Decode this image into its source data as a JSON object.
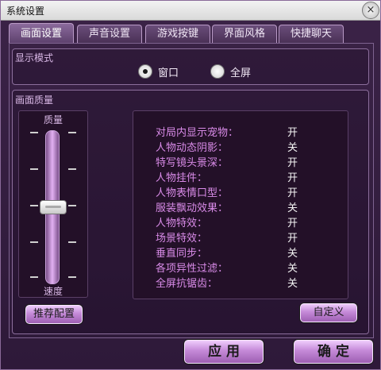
{
  "window": {
    "title": "系统设置",
    "close_glyph": "×"
  },
  "tabs": [
    {
      "label": "画面设置",
      "active": true
    },
    {
      "label": "声音设置",
      "active": false
    },
    {
      "label": "游戏按键",
      "active": false
    },
    {
      "label": "界面风格",
      "active": false
    },
    {
      "label": "快捷聊天",
      "active": false
    }
  ],
  "display_mode": {
    "label": "显示模式",
    "options": [
      {
        "label": "窗口",
        "checked": true
      },
      {
        "label": "全屏",
        "checked": false
      }
    ]
  },
  "quality": {
    "label": "画面质量",
    "slider_top": "质量",
    "slider_bottom": "速度",
    "level_fraction": 0.5,
    "recommend_button": "推荐配置",
    "custom_button": "自定义",
    "settings": [
      {
        "label": "对局内显示宠物：",
        "value": "开"
      },
      {
        "label": "人物动态阴影：",
        "value": "关"
      },
      {
        "label": "特写镜头景深：",
        "value": "开"
      },
      {
        "label": "人物挂件：",
        "value": "开"
      },
      {
        "label": "人物表情口型：",
        "value": "开"
      },
      {
        "label": "服装飘动效果：",
        "value": "关"
      },
      {
        "label": "人物特效：",
        "value": "开"
      },
      {
        "label": "场景特效：",
        "value": "开"
      },
      {
        "label": "垂直同步：",
        "value": "关"
      },
      {
        "label": "各项异性过滤：",
        "value": "关"
      },
      {
        "label": "全屏抗锯齿：",
        "value": "关"
      }
    ]
  },
  "footer": {
    "apply_button": "应 用",
    "ok_button": "确 定"
  },
  "colors": {
    "accent": "#c58ad8",
    "panel_bg": "#231028",
    "label_pink": "#d98be8"
  }
}
